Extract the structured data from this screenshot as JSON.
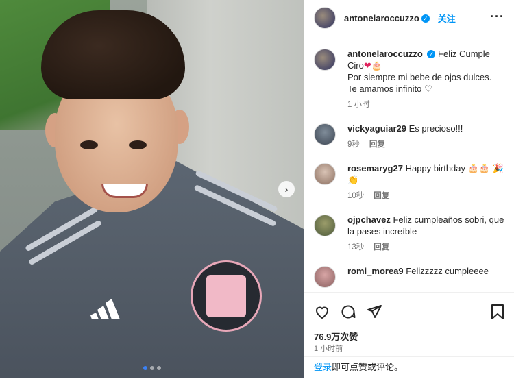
{
  "header": {
    "username": "antonelaroccuzzo",
    "verified_glyph": "✓",
    "follow_label": "关注",
    "more_glyph": "···"
  },
  "caption": {
    "username": "antonelaroccuzzo",
    "line1": "Feliz Cumple Ciro",
    "heart": "❤",
    "cake": "🎂",
    "line2": "Por siempre mi bebe de ojos dulces.",
    "line3": "Te amamos infinito",
    "heart2": "♡",
    "time": "1 小时"
  },
  "comments": [
    {
      "username": "vickyaguiar29",
      "text": "Es precioso!!!",
      "time": "9秒",
      "reply": "回复"
    },
    {
      "username": "rosemaryg27",
      "text": "Happy birthday 🎂🎂 🎉👏",
      "time": "10秒",
      "reply": "回复"
    },
    {
      "username": "ojpchavez",
      "text": "Feliz cumpleaños sobri, que la pases increíble",
      "time": "13秒",
      "reply": "回复"
    },
    {
      "username": "romi_morea9",
      "text": "Felizzzzz cumpleeee",
      "time": "",
      "reply": ""
    }
  ],
  "likes": "76.9万次赞",
  "post_time": "1 小时前",
  "login": {
    "link": "登录",
    "text": "即可点赞或评论。"
  },
  "photo": {
    "dots": 3,
    "active_dot": 1
  },
  "icons": [
    "heart-icon",
    "comment-icon",
    "share-icon",
    "bookmark-icon",
    "chevron-right-icon"
  ],
  "colors": {
    "accent": "#0095f6",
    "text": "#262626",
    "muted": "#737373"
  }
}
